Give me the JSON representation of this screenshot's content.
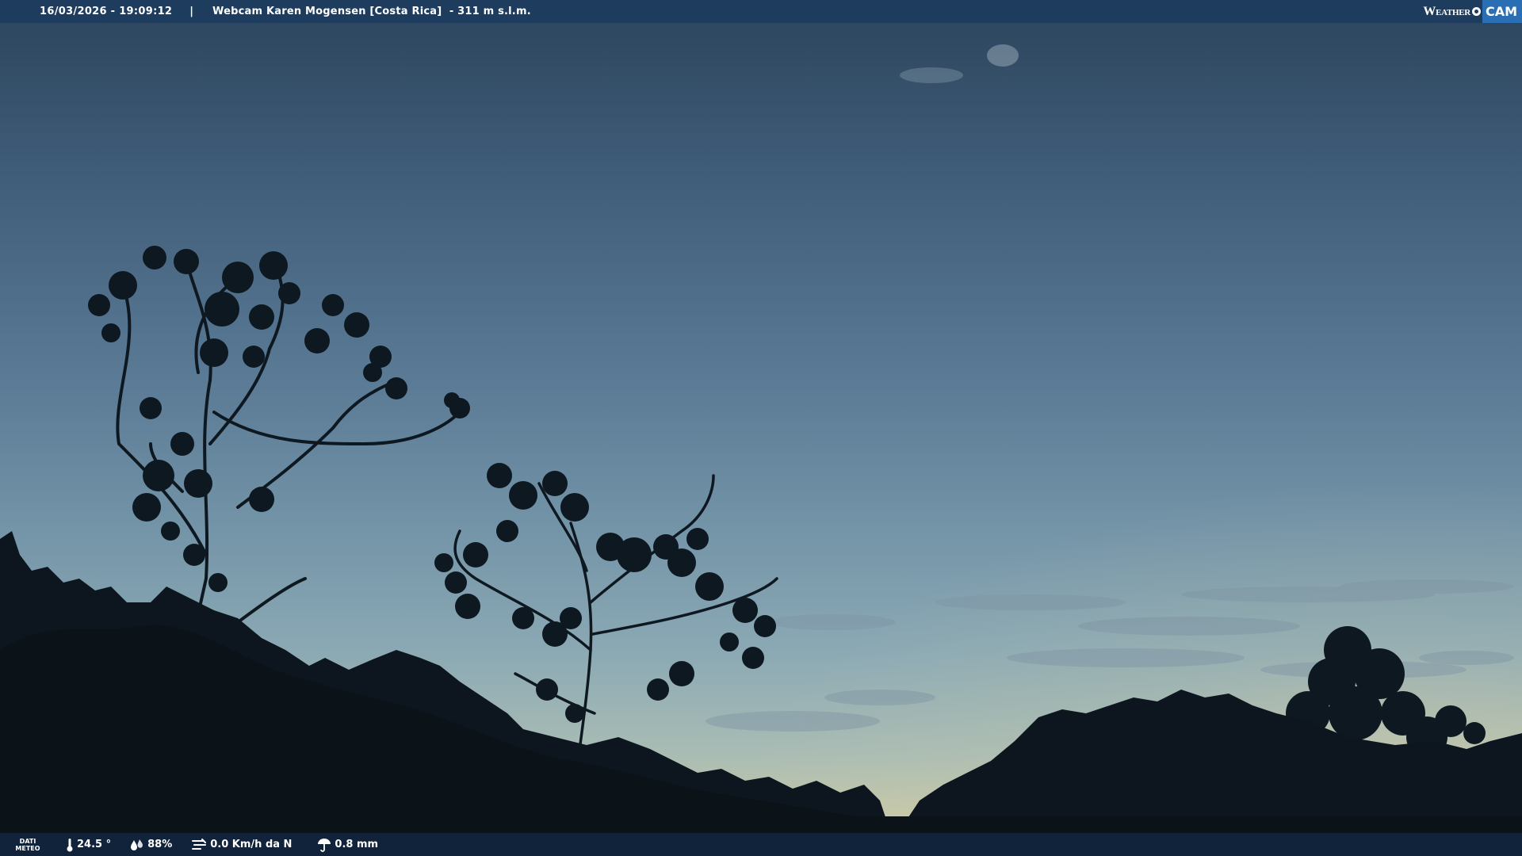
{
  "header": {
    "timestamp": "16/03/2026 - 19:09:12",
    "separator": "|",
    "title": "Webcam Karen Mogensen [Costa Rica]  - 311 m s.l.m.",
    "logo_left": "Weather",
    "logo_right": "CAM"
  },
  "footer": {
    "dati_line1": "DATI",
    "dati_line2": "METEO",
    "temperature": "24.5 °",
    "humidity": "88%",
    "wind": "0.0 Km/h da N",
    "rain": "0.8 mm"
  },
  "icons": {
    "temperature": "thermometer-icon",
    "humidity": "humidity-drops-icon",
    "wind": "wind-icon",
    "rain": "umbrella-icon",
    "logo": "eye-icon"
  },
  "colors": {
    "header_bar": "#1d3c5e",
    "footer_bar": "#10233a",
    "logo_accent": "#2a6fb3",
    "text": "#ffffff"
  }
}
